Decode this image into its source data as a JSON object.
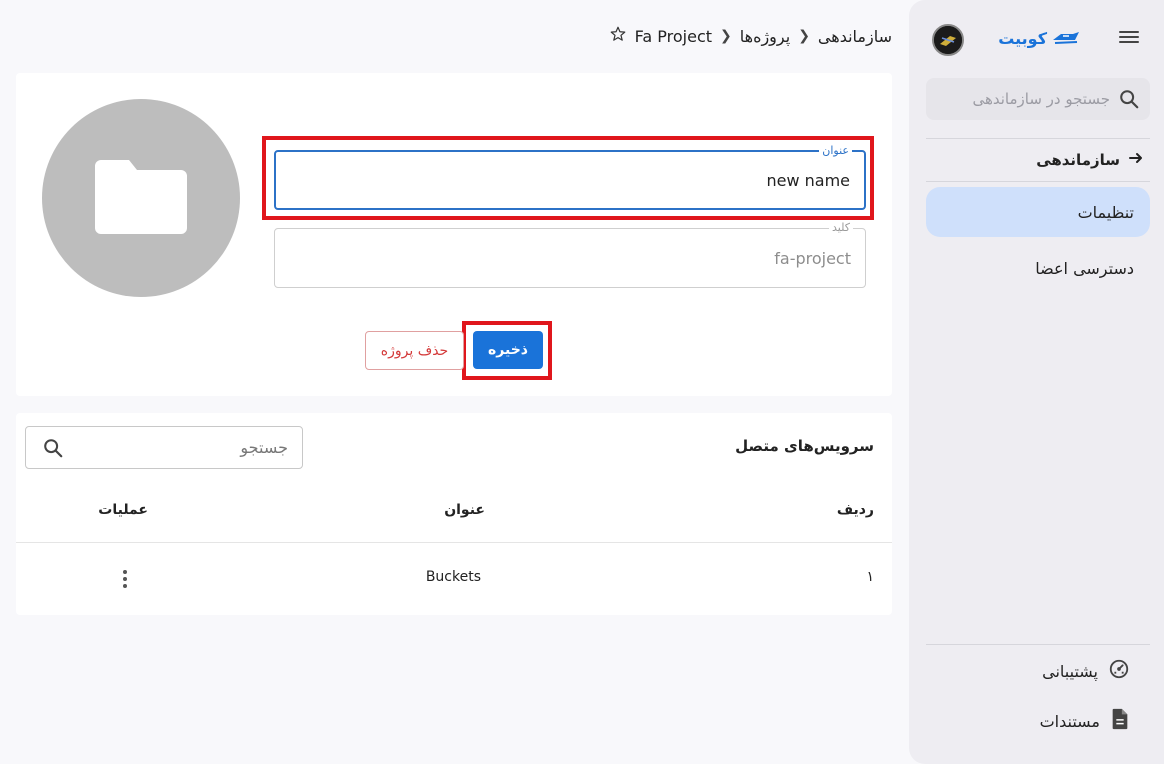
{
  "sidebar": {
    "brand_name": "کوبیت",
    "search_placeholder": "جستجو در سازماندهی",
    "back_label": "سازماندهی",
    "items": [
      {
        "label": "تنظیمات",
        "active": true
      },
      {
        "label": "دسترسی اعضا",
        "active": false
      }
    ],
    "footer": [
      {
        "label": "پشتیبانی",
        "icon": "support-icon"
      },
      {
        "label": "مستندات",
        "icon": "document-icon"
      }
    ]
  },
  "breadcrumb": {
    "items": [
      "سازماندهی",
      "پروژه‌ها"
    ],
    "current": "Fa Project"
  },
  "project_form": {
    "title_label": "عنوان",
    "title_value": "new name",
    "key_label": "کلید",
    "key_value": "fa-project",
    "save_label": "ذخیره",
    "delete_label": "حذف پروژه"
  },
  "services": {
    "title": "سرویس‌های متصل",
    "search_placeholder": "جستجو",
    "columns": [
      "ردیف",
      "عنوان",
      "عملیات"
    ],
    "rows": [
      {
        "index": "۱",
        "title": "Buckets"
      }
    ]
  },
  "colors": {
    "accent": "#1a73d9",
    "danger": "#d43a3a",
    "highlight": "#e0161c",
    "active_item_bg": "#cfe0fb"
  }
}
